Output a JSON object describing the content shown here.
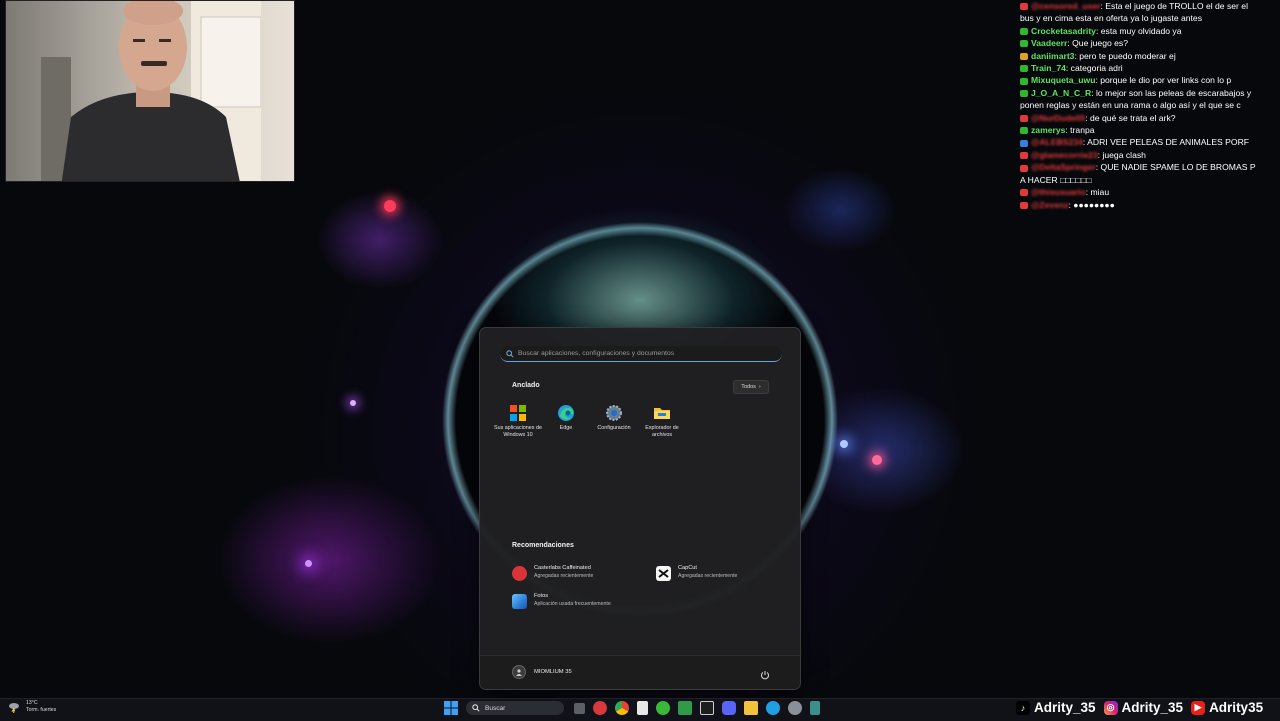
{
  "chat": [
    {
      "user": "@censored_user",
      "user_color": "#e23a3a",
      "censored": true,
      "text": ": Esta el juego de TROLLO el de ser el",
      "badge": "#e23a3a"
    },
    {
      "user": "",
      "user_color": "#ffffff",
      "censored": false,
      "text": "bus y en cima esta en oferta ya lo jugaste antes",
      "badge": ""
    },
    {
      "user": "Crocketasadrity",
      "user_color": "#5fe35f",
      "censored": false,
      "text": ": esta muy olvidado ya",
      "badge": "#2fb82f"
    },
    {
      "user": "Vaadeerr",
      "user_color": "#5fe35f",
      "censored": false,
      "text": ": Que juego es?",
      "badge": "#2fb82f"
    },
    {
      "user": "daniimart3",
      "user_color": "#5fe35f",
      "censored": false,
      "text": ": pero te puedo moderar ej",
      "badge": "#e0a020"
    },
    {
      "user": "Train_74",
      "user_color": "#5fe35f",
      "censored": false,
      "text": ": categoria adri",
      "badge": "#2fb82f"
    },
    {
      "user": "Mixuqueta_uwu",
      "user_color": "#5fe35f",
      "censored": false,
      "text": ": porque le dio por ver links con lo p",
      "badge": "#2fb82f"
    },
    {
      "user": "J_O_A_N_C_R",
      "user_color": "#5fe35f",
      "censored": false,
      "text": ": lo mejor son las peleas de escarabajos y",
      "badge": "#2fb82f"
    },
    {
      "user": "",
      "user_color": "#ffffff",
      "censored": false,
      "text": "ponen reglas y están en una rama o algo así y el que se c",
      "badge": ""
    },
    {
      "user": "@NurDude05",
      "user_color": "#e23a3a",
      "censored": true,
      "text": ": de qué se trata el ark?",
      "badge": "#e23a3a"
    },
    {
      "user": "zamerys",
      "user_color": "#5fe35f",
      "censored": false,
      "text": ": tranpa",
      "badge": "#2fb82f"
    },
    {
      "user": "@ALEBS234",
      "user_color": "#e23a3a",
      "censored": true,
      "text": ": ADRI VEE PELEAS DE ANIMALES PORF",
      "badge": "#3a7ee2"
    },
    {
      "user": "@glamecorrie23",
      "user_color": "#e23a3a",
      "censored": true,
      "text": ": juega clash",
      "badge": "#e23a3a"
    },
    {
      "user": "@DeltaSpringer",
      "user_color": "#e23a3a",
      "censored": true,
      "text": ": QUE NADIE SPAME LO DE BROMAS P",
      "badge": "#e23a3a"
    },
    {
      "user": "",
      "user_color": "#ffffff",
      "censored": false,
      "text": "A HACER □□□□□□",
      "badge": ""
    },
    {
      "user": "@thisusuario",
      "user_color": "#e23a3a",
      "censored": true,
      "text": ": miau",
      "badge": "#e23a3a"
    },
    {
      "user": "@Zevenz",
      "user_color": "#e23a3a",
      "censored": true,
      "text": ": ●●●●●●●●",
      "badge": "#e23a3a"
    }
  ],
  "start_menu": {
    "search_placeholder": "Buscar aplicaciones, configuraciones y documentos",
    "pinned_title": "Anclado",
    "all_button": "Todos",
    "pinned": [
      {
        "label": "Sus aplicaciones de Windows 10",
        "icon": "windows-apps-icon"
      },
      {
        "label": "Edge",
        "icon": "edge-icon"
      },
      {
        "label": "Configuración",
        "icon": "settings-gear-icon"
      },
      {
        "label": "Explorador de archivos",
        "icon": "folder-icon"
      }
    ],
    "recommendations_title": "Recomendaciones",
    "recommendations": [
      {
        "name": "Casterlabs Caffeinated",
        "sub": "Agregadas recientemente",
        "icon_color": "#d8343a",
        "icon": "casterlabs-icon"
      },
      {
        "name": "CapCut",
        "sub": "Agregadas recientemente",
        "icon_color": "#f5f5f5",
        "icon": "capcut-icon"
      },
      {
        "name": "Fotos",
        "sub": "Aplicación usada frecuentemente",
        "icon_color": "#2b7fd8",
        "icon": "photos-icon"
      }
    ],
    "user_name": "MIOMLIUM 35"
  },
  "taskbar": {
    "search_label": "Buscar",
    "weather_temp": "13°C",
    "weather_desc": "Torm. fuertes"
  },
  "socials": [
    {
      "platform": "tiktok",
      "handle": "Adrity_35",
      "color": "#000000"
    },
    {
      "platform": "instagram",
      "handle": "Adrity_35",
      "color": "#d6246e"
    },
    {
      "platform": "youtube",
      "handle": "Adrity35",
      "color": "#e62117"
    }
  ],
  "colors": {
    "accent": "#6aa3d8",
    "menu_bg": "#202022"
  }
}
